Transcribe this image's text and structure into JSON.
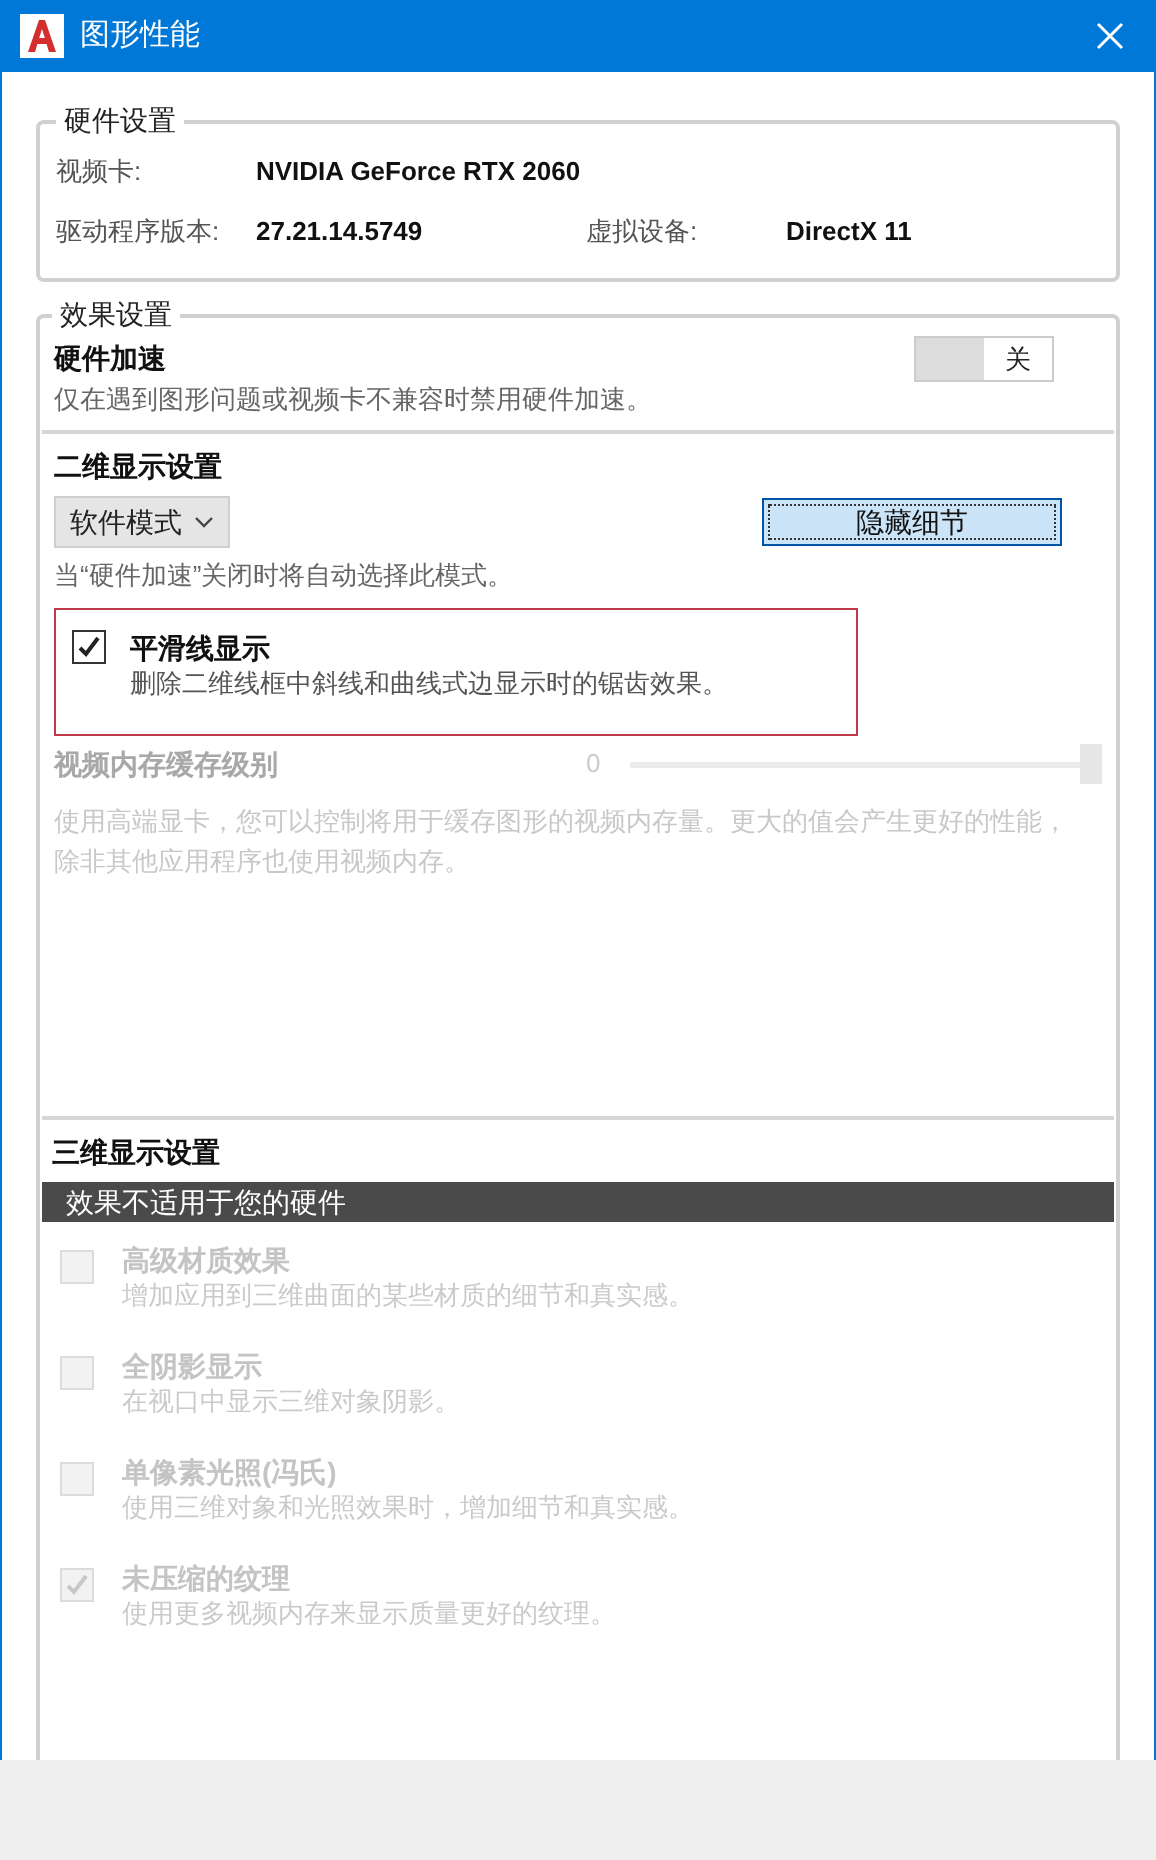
{
  "window": {
    "title": "图形性能"
  },
  "hardware": {
    "legend": "硬件设置",
    "rows": [
      {
        "label": "视频卡:",
        "value": "NVIDIA GeForce RTX 2060"
      },
      {
        "label": "驱动程序版本:",
        "value": "27.21.14.5749",
        "label2": "虚拟设备:",
        "value2": "DirectX 11"
      }
    ]
  },
  "effects": {
    "legend": "效果设置",
    "acceleration": {
      "title": "硬件加速",
      "description": "仅在遇到图形问题或视频卡不兼容时禁用硬件加速。",
      "on": false,
      "toggle_label": "关"
    },
    "display_2d": {
      "heading": "二维显示设置",
      "mode": "软件模式",
      "details_button": "隐藏细节",
      "note": "当“硬件加速”关闭时将自动选择此模式。",
      "smooth_line": {
        "title": "平滑线显示",
        "description": "删除二维线框中斜线和曲线式边显示时的锯齿效果。",
        "checked": true,
        "disabled": false,
        "highlighted": true
      },
      "cache": {
        "label": "视频内存缓存级别",
        "reading": "0",
        "level": 1,
        "disabled": true,
        "description": "使用高端显卡，您可以控制将用于缓存图形的视频内存量。更大的值会产生更好的性能，除非其他应用程序也使用视频内存。"
      }
    },
    "display_3d": {
      "heading": "三维显示设置",
      "banner": "效果不适用于您的硬件",
      "items": [
        {
          "title": "高级材质效果",
          "description": "增加应用到三维曲面的某些材质的细节和真实感。",
          "checked": false,
          "disabled": true
        },
        {
          "title": "全阴影显示",
          "description": "在视口中显示三维对象阴影。",
          "checked": false,
          "disabled": true
        },
        {
          "title": "单像素光照(冯氏)",
          "description": "使用三维对象和光照效果时，增加细节和真实感。",
          "checked": false,
          "disabled": true
        },
        {
          "title": "未压缩的纹理",
          "description": "使用更多视频内存来显示质量更好的纹理。",
          "checked": true,
          "disabled": true
        }
      ]
    }
  }
}
